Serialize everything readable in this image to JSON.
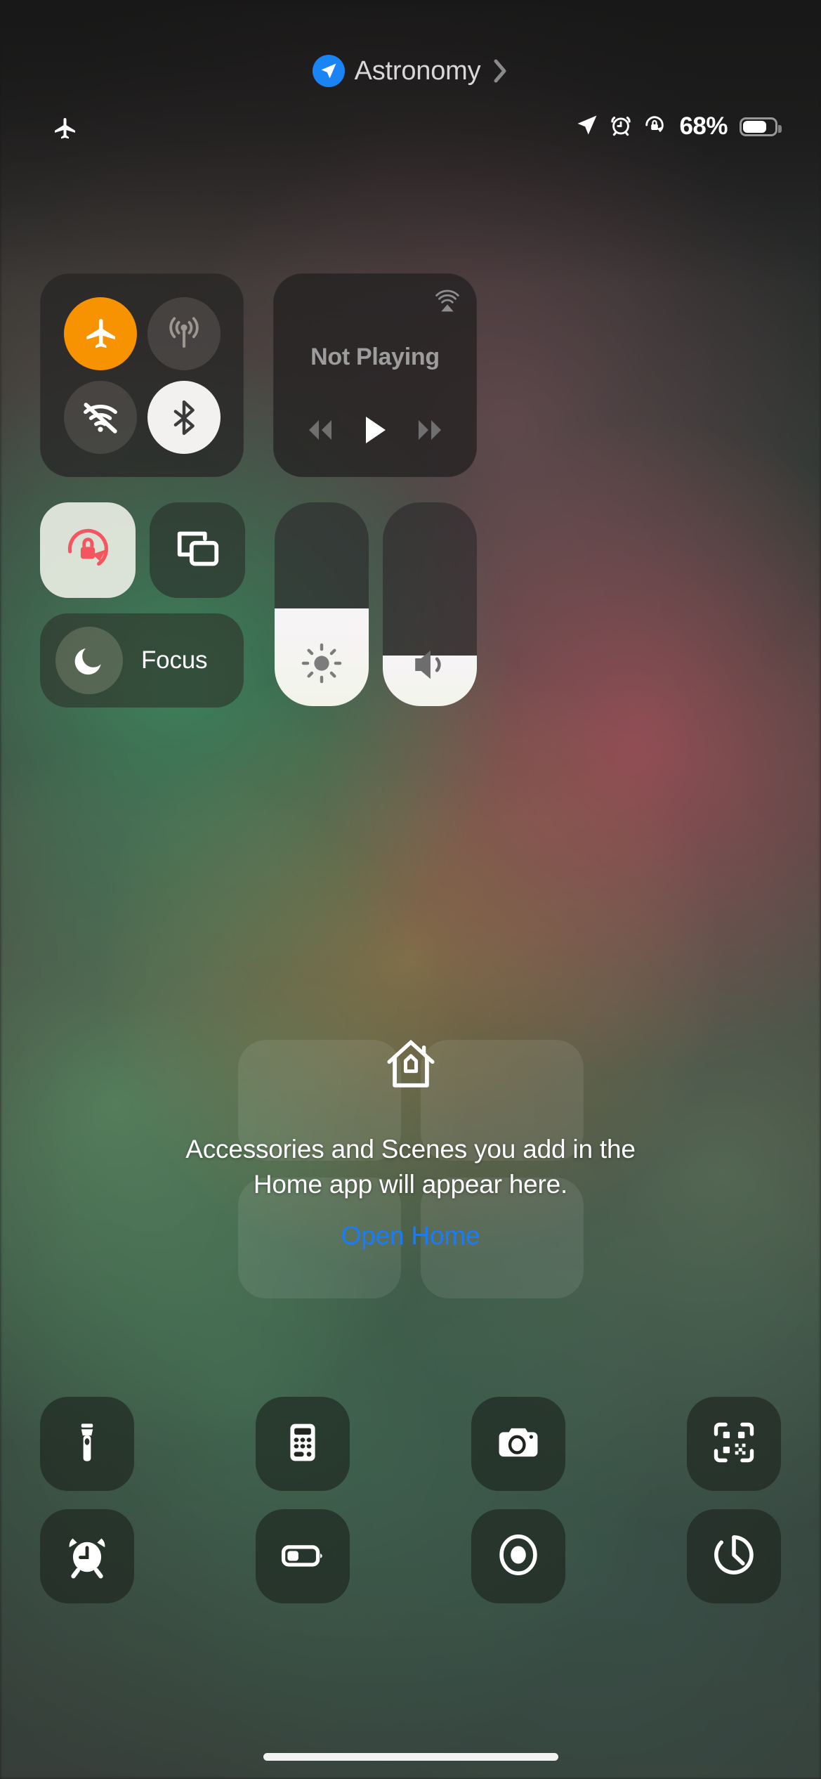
{
  "header": {
    "location_icon": "location-arrow-icon",
    "title": "Astronomy",
    "chevron": "chevron-right-icon",
    "accent_blue": "#1a84f5"
  },
  "status_bar": {
    "left_icon": "airplane-mode-icon",
    "icons": [
      "location-arrow-icon",
      "alarm-clock-icon",
      "rotation-lock-icon"
    ],
    "battery_percent": "68%",
    "battery_level": 68,
    "battery_icon": "battery-icon"
  },
  "connectivity": {
    "airplane": {
      "name": "airplane-mode-toggle",
      "state": "on",
      "color": "#f79200",
      "icon": "airplane-icon"
    },
    "cellular": {
      "name": "cellular-data-toggle",
      "state": "off",
      "icon": "cellular-antenna-icon"
    },
    "wifi": {
      "name": "wifi-toggle",
      "state": "off",
      "icon": "wifi-slash-icon"
    },
    "bluetooth": {
      "name": "bluetooth-toggle",
      "state": "on",
      "color": "#f2f1ef",
      "icon": "bluetooth-icon"
    }
  },
  "media": {
    "airplay_icon": "airplay-icon",
    "status": "Not Playing",
    "rewind_icon": "rewind-icon",
    "play_icon": "play-icon",
    "forward_icon": "fast-forward-icon"
  },
  "tiles": {
    "rotation_lock": {
      "label": "rotation-lock",
      "state": "on",
      "icon": "rotation-lock-icon",
      "icon_color": "#f4555f"
    },
    "screen_mirroring": {
      "label": "screen-mirroring",
      "state": "off",
      "icon": "screen-mirroring-icon"
    },
    "focus": {
      "label": "Focus",
      "icon": "moon-icon",
      "state": "off"
    }
  },
  "sliders": {
    "brightness": {
      "name": "brightness-slider",
      "icon": "sun-icon",
      "value": 48
    },
    "volume": {
      "name": "volume-slider",
      "icon": "speaker-icon",
      "value": 25
    }
  },
  "home": {
    "icon": "house-icon",
    "message_line1": "Accessories and Scenes you add in the",
    "message_line2": "Home app will appear here.",
    "link": "Open Home",
    "link_color": "#1a7cf7"
  },
  "utilities": {
    "row1": [
      {
        "name": "flashlight-button",
        "icon": "flashlight-icon"
      },
      {
        "name": "calculator-button",
        "icon": "calculator-icon"
      },
      {
        "name": "camera-button",
        "icon": "camera-icon"
      },
      {
        "name": "qr-scanner-button",
        "icon": "qr-code-icon"
      }
    ],
    "row2": [
      {
        "name": "alarm-button",
        "icon": "alarm-clock-icon"
      },
      {
        "name": "low-power-mode-button",
        "icon": "battery-low-power-icon"
      },
      {
        "name": "screen-recording-button",
        "icon": "record-circle-icon"
      },
      {
        "name": "timer-button",
        "icon": "timer-icon"
      }
    ]
  },
  "home_indicator": "home-indicator-bar"
}
